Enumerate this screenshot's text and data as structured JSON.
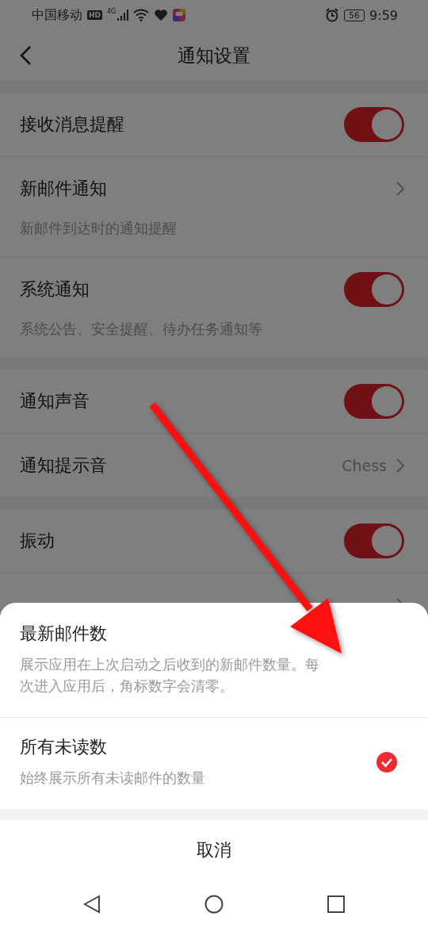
{
  "status_bar": {
    "carrier": "中国移动",
    "hd": "HD",
    "network": "4G",
    "battery": "56",
    "time": "9:59"
  },
  "header": {
    "title": "通知设置"
  },
  "groups": [
    {
      "items": [
        {
          "kind": "toggle",
          "label": "接收消息提醒",
          "on": true
        },
        {
          "kind": "link",
          "label": "新邮件通知",
          "description": "新邮件到达时的通知提醒"
        },
        {
          "kind": "toggle",
          "label": "系统通知",
          "on": true,
          "description": "系统公告、安全提醒、待办任务通知等"
        }
      ]
    },
    {
      "items": [
        {
          "kind": "toggle",
          "label": "通知声音",
          "on": true
        },
        {
          "kind": "link",
          "label": "通知提示音",
          "value": "Chess"
        }
      ]
    },
    {
      "items": [
        {
          "kind": "toggle",
          "label": "振动",
          "on": true
        },
        {
          "kind": "link"
        }
      ]
    }
  ],
  "sheet": {
    "options": [
      {
        "title": "最新邮件数",
        "description": "展示应用在上次启动之后收到的新邮件数量。每次进入应用后，角标数字会清零。",
        "selected": false
      },
      {
        "title": "所有未读数",
        "description": "始终展示所有未读邮件的数量",
        "selected": true
      }
    ],
    "cancel": "取消"
  }
}
